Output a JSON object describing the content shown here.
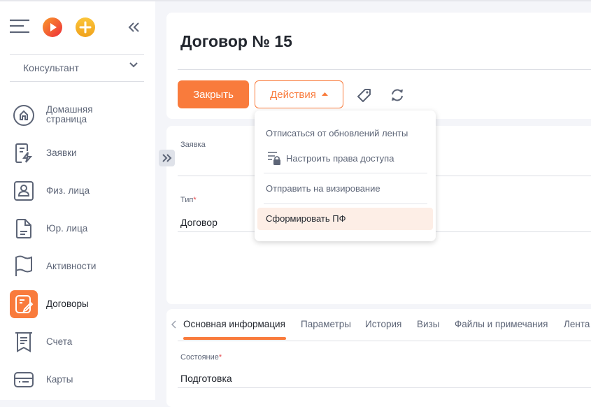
{
  "sidebar": {
    "role_select": "Консультант",
    "items": [
      {
        "label": "Домашняя",
        "label2": "страница",
        "icon": "home-icon"
      },
      {
        "label": "Заявки",
        "icon": "request-icon"
      },
      {
        "label": "Физ. лица",
        "icon": "person-icon"
      },
      {
        "label": "Юр. лица",
        "icon": "document-icon"
      },
      {
        "label": "Активности",
        "icon": "flag-icon"
      },
      {
        "label": "Договоры",
        "icon": "contract-icon",
        "active": true
      },
      {
        "label": "Счета",
        "icon": "receipt-icon"
      },
      {
        "label": "Карты",
        "icon": "card-icon"
      }
    ]
  },
  "header": {
    "title": "Договор № 15",
    "close_label": "Закрыть",
    "actions_label": "Действия"
  },
  "menu": {
    "items": [
      "Отписаться от обновлений ленты",
      "Настроить права доступа",
      "Отправить на визирование",
      "Сформировать ПФ"
    ]
  },
  "form": {
    "request_label": "Заявка",
    "request_value": "",
    "type_label": "Тип",
    "type_value": "Договор"
  },
  "tabs": [
    "Основная информация",
    "Параметры",
    "История",
    "Визы",
    "Файлы и примечания",
    "Лента"
  ],
  "details": {
    "state_label": "Состояние",
    "state_value": "Подготовка"
  },
  "colors": {
    "accent": "#f97b3c",
    "highlight": "#fdeee6",
    "text_muted": "#5d6577"
  }
}
